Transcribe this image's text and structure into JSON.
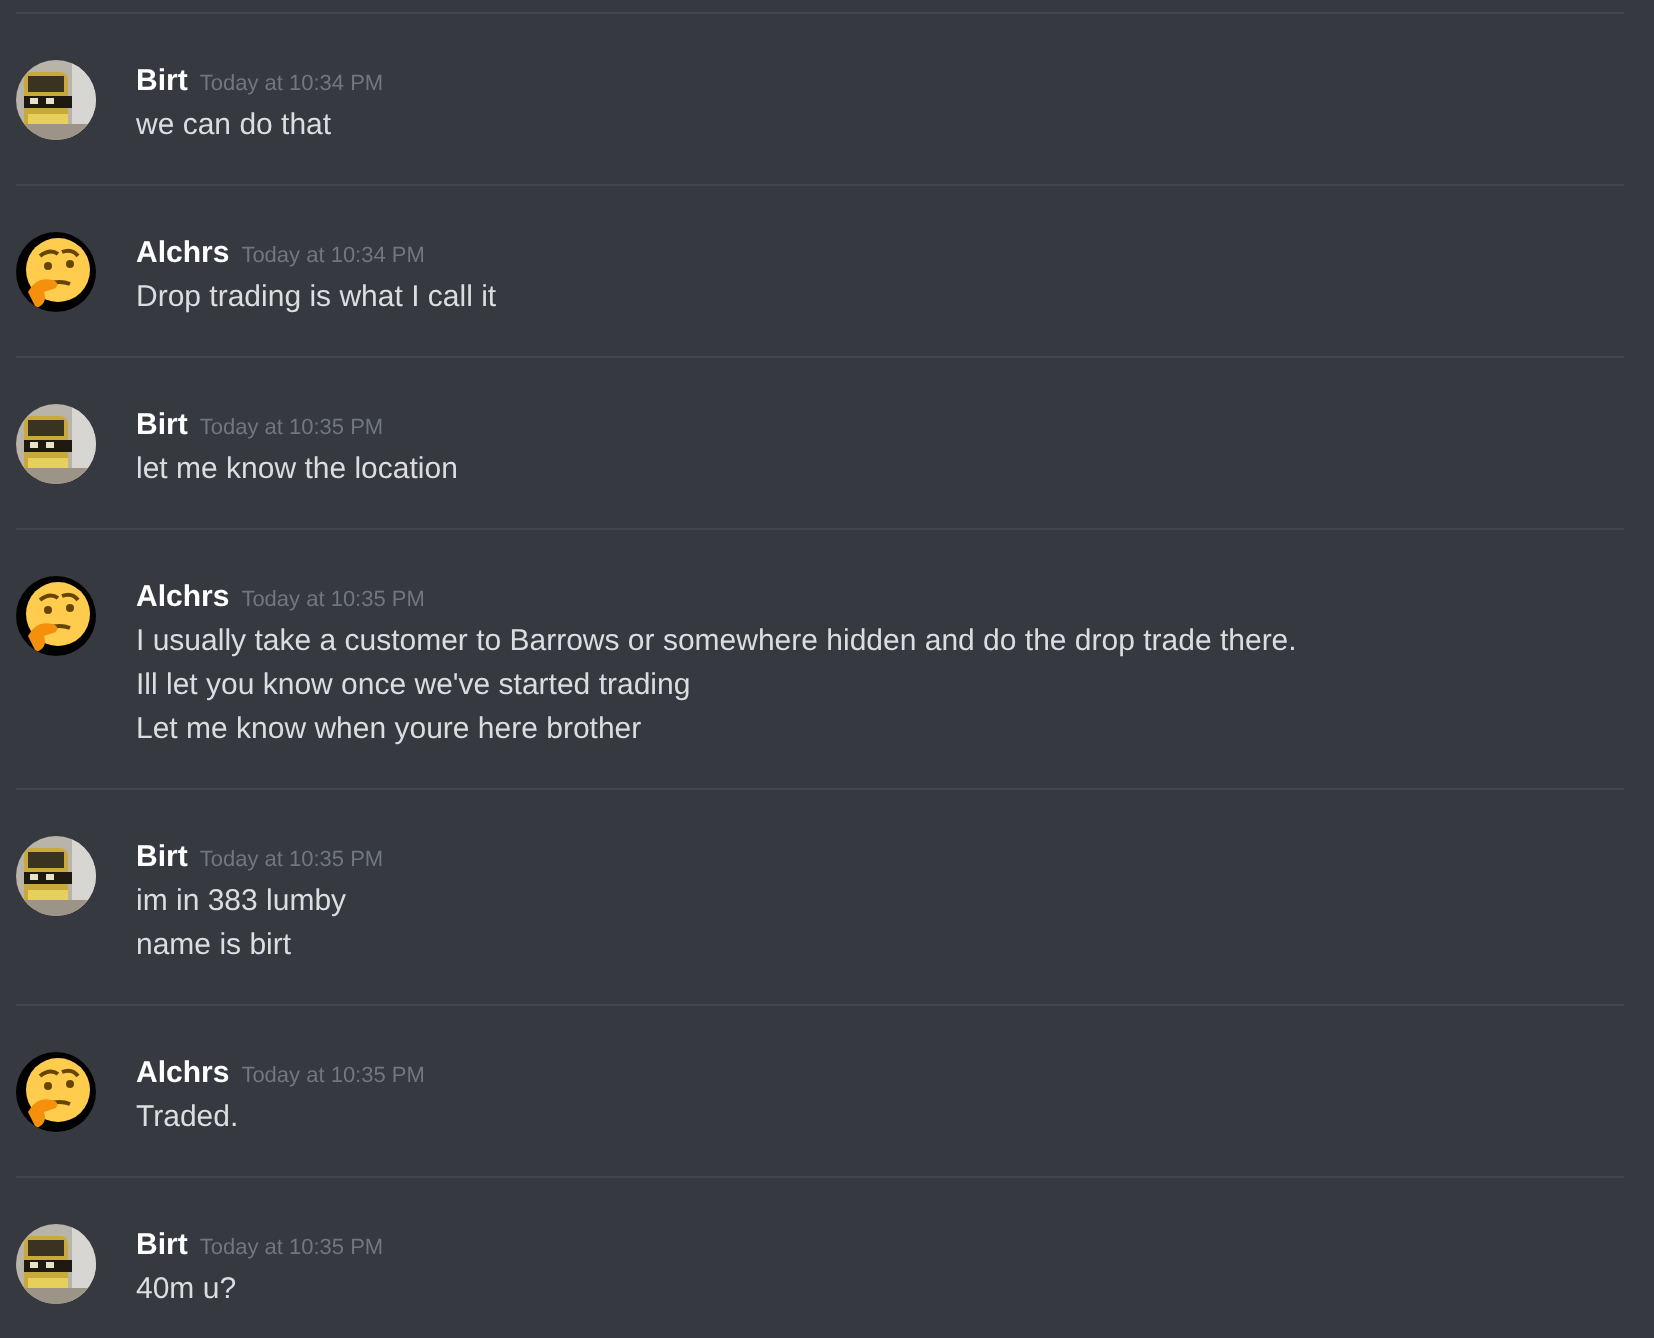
{
  "messages": [
    {
      "author": "Birt",
      "time": "Today at 10:34 PM",
      "lines": [
        "we can do that"
      ]
    },
    {
      "author": "Alchrs",
      "kind": "emoji",
      "time": "Today at 10:34 PM",
      "lines": [
        "Drop trading is what I call it"
      ]
    },
    {
      "author": "Birt",
      "time": "Today at 10:35 PM",
      "lines": [
        "let me know the location"
      ]
    },
    {
      "author": "Alchrs",
      "kind": "emoji",
      "time": "Today at 10:35 PM",
      "lines": [
        "I usually take a customer to Barrows or somewhere hidden and do the drop trade there.",
        "Ill let you know once we've started trading",
        "Let me know when youre here brother"
      ]
    },
    {
      "author": "Birt",
      "time": "Today at 10:35 PM",
      "lines": [
        "im in 383 lumby",
        "name is birt"
      ]
    },
    {
      "author": "Alchrs",
      "kind": "emoji",
      "time": "Today at 10:35 PM",
      "lines": [
        "Traded."
      ]
    },
    {
      "author": "Birt",
      "time": "Today at 10:35 PM",
      "lines": [
        "40m u?"
      ]
    }
  ]
}
